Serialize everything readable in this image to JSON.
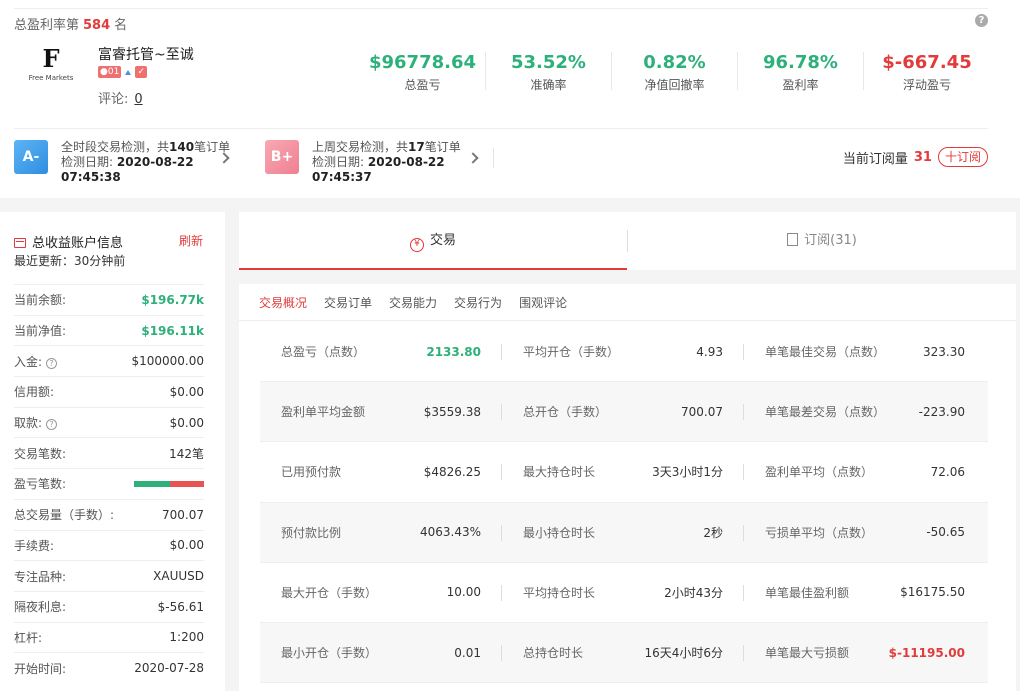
{
  "header": {
    "rank_prefix": "总盈利率第",
    "rank_value": "584",
    "rank_suffix": "名",
    "help": "?",
    "logo_letter": "F",
    "logo_text": "Free Markets",
    "trader_name": "富睿托管~至诚",
    "badge_level": "01",
    "comment_label": "评论:",
    "comment_count": "0",
    "stats": [
      {
        "value": "$96778.64",
        "label": "总盈亏",
        "color": "green"
      },
      {
        "value": "53.52%",
        "label": "准确率",
        "color": "green"
      },
      {
        "value": "0.82%",
        "label": "净值回撤率",
        "color": "green"
      },
      {
        "value": "96.78%",
        "label": "盈利率",
        "color": "green"
      },
      {
        "value": "$-667.45",
        "label": "浮动盈亏",
        "color": "red"
      }
    ],
    "checks": [
      {
        "grade": "A-",
        "color": "#3a9ef0",
        "line1_pre": "全时段交易检测，共",
        "line1_num": "140",
        "line1_post": "笔订单",
        "date_label": "检测日期:",
        "date": "2020-08-22",
        "time": "07:45:38"
      },
      {
        "grade": "B+",
        "color": "#f08a9a",
        "line1_pre": "上周交易检测，共",
        "line1_num": "17",
        "line1_post": "笔订单",
        "date_label": "检测日期:",
        "date": "2020-08-22",
        "time": "07:45:37"
      }
    ],
    "subscribe_label": "当前订阅量",
    "subscribe_count": "31",
    "subscribe_button": "十订阅"
  },
  "account": {
    "title": "总收益账户信息",
    "refresh": "刷新",
    "updated": "最近更新：30分钟前",
    "rows": [
      {
        "k": "当前余额:",
        "v": "$196.77k",
        "green": true
      },
      {
        "k": "当前净值:",
        "v": "$196.11k",
        "green": true
      },
      {
        "k": "入金:",
        "v": "$100000.00",
        "help": true
      },
      {
        "k": "信用额:",
        "v": "$0.00"
      },
      {
        "k": "取款:",
        "v": "$0.00",
        "help": true
      },
      {
        "k": "交易笔数:",
        "v": "142笔"
      },
      {
        "k": "盈亏笔数:",
        "v": "",
        "bar": true
      },
      {
        "k": "总交易量（手数）:",
        "v": "700.07"
      },
      {
        "k": "手续费:",
        "v": "$0.00"
      },
      {
        "k": "专注品种:",
        "v": "XAUUSD"
      },
      {
        "k": "隔夜利息:",
        "v": "$-56.61"
      },
      {
        "k": "杠杆:",
        "v": "1:200"
      },
      {
        "k": "开始时间:",
        "v": "2020-07-28"
      }
    ],
    "win_ratio": 0.52
  },
  "tabs": {
    "trade": "交易",
    "subscribe": "订阅(31)",
    "trade_icon": "¥"
  },
  "subtabs": [
    "交易概况",
    "交易订单",
    "交易能力",
    "交易行为",
    "围观评论"
  ],
  "overview": [
    [
      {
        "k": "总盈亏（点数）",
        "v": "2133.80",
        "c": "g"
      },
      {
        "k": "平均开仓（手数）",
        "v": "4.93"
      },
      {
        "k": "单笔最佳交易（点数）",
        "v": "323.30"
      }
    ],
    [
      {
        "k": "盈利单平均金额",
        "v": "$3559.38"
      },
      {
        "k": "总开仓（手数）",
        "v": "700.07"
      },
      {
        "k": "单笔最差交易（点数）",
        "v": "-223.90"
      }
    ],
    [
      {
        "k": "已用预付款",
        "v": "$4826.25"
      },
      {
        "k": "最大持仓时长",
        "v": "3天3小时1分"
      },
      {
        "k": "盈利单平均（点数）",
        "v": "72.06"
      }
    ],
    [
      {
        "k": "预付款比例",
        "v": "4063.43%"
      },
      {
        "k": "最小持仓时长",
        "v": "2秒"
      },
      {
        "k": "亏损单平均（点数）",
        "v": "-50.65"
      }
    ],
    [
      {
        "k": "最大开仓（手数）",
        "v": "10.00"
      },
      {
        "k": "平均持仓时长",
        "v": "2小时43分"
      },
      {
        "k": "单笔最佳盈利额",
        "v": "$16175.50"
      }
    ],
    [
      {
        "k": "最小开仓（手数）",
        "v": "0.01"
      },
      {
        "k": "总持仓时长",
        "v": "16天4小时6分"
      },
      {
        "k": "单笔最大亏损额",
        "v": "$-11195.00",
        "c": "r"
      }
    ]
  ]
}
